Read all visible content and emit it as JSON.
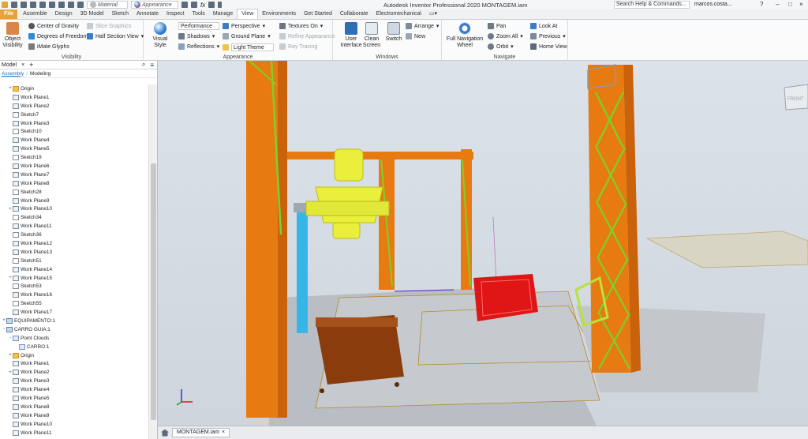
{
  "qat": {
    "material_label": "Material",
    "appearance_label": "Appearance",
    "fx_label": "fx"
  },
  "window": {
    "title": "Autodesk Inventor Professional 2020   MONTAGEM.iam",
    "search_placeholder": "Search Help & Commands...",
    "user": "marcos.costa..."
  },
  "tabs": [
    "File",
    "Assemble",
    "Design",
    "3D Model",
    "Sketch",
    "Annotate",
    "Inspect",
    "Tools",
    "Manage",
    "View",
    "Environments",
    "Get Started",
    "Collaborate",
    "Electromechanical"
  ],
  "active_tab": "View",
  "ribbon": {
    "visibility": {
      "label": "Visibility",
      "object_visibility": "Object Visibility",
      "center_of_gravity": "Center of Gravity",
      "degrees_of_freedom": "Degrees of Freedom",
      "imate_glyphs": "iMate Glyphs",
      "slice_graphics": "Slice Graphics",
      "half_section_view": "Half Section View"
    },
    "appearance": {
      "label": "Appearance",
      "visual_style": "Visual Style",
      "performance": "Performance",
      "shadows": "Shadows",
      "reflections": "Reflections",
      "perspective": "Perspective",
      "ground_plane": "Ground Plane",
      "light_theme": "Light Theme",
      "textures_on": "Textures On",
      "refine_appearance": "Refine Appearance",
      "ray_tracing": "Ray Tracing"
    },
    "windows": {
      "label": "Windows",
      "user_interface": "User Interface",
      "clean_screen": "Clean Screen",
      "switch": "Switch",
      "arrange": "Arrange",
      "new": "New"
    },
    "navigate": {
      "label": "Navigate",
      "full_nav_wheel": "Full Navigation Wheel",
      "pan": "Pan",
      "zoom_all": "Zoom All",
      "orbit": "Orbit",
      "look_at": "Look At",
      "previous": "Previous",
      "home_view": "Home View"
    }
  },
  "browser": {
    "title": "Model",
    "tab_assembly": "Assembly",
    "tab_modeling": "Modeling",
    "tree": [
      {
        "label": "Origin",
        "type": "folder",
        "indent": 1,
        "exp": "+"
      },
      {
        "label": "Work Plane1",
        "type": "plane",
        "indent": 1,
        "exp": ""
      },
      {
        "label": "Work Plane2",
        "type": "plane",
        "indent": 1,
        "exp": ""
      },
      {
        "label": "Sketch7",
        "type": "sketch",
        "indent": 1,
        "exp": ""
      },
      {
        "label": "Work Plane3",
        "type": "plane",
        "indent": 1,
        "exp": ""
      },
      {
        "label": "Sketch10",
        "type": "sketch",
        "indent": 1,
        "exp": ""
      },
      {
        "label": "Work Plane4",
        "type": "plane",
        "indent": 1,
        "exp": ""
      },
      {
        "label": "Work Plane5",
        "type": "plane",
        "indent": 1,
        "exp": ""
      },
      {
        "label": "Sketch19",
        "type": "sketch",
        "indent": 1,
        "exp": ""
      },
      {
        "label": "Work Plane6",
        "type": "plane",
        "indent": 1,
        "exp": ""
      },
      {
        "label": "Work Plane7",
        "type": "plane",
        "indent": 1,
        "exp": ""
      },
      {
        "label": "Work Plane8",
        "type": "plane",
        "indent": 1,
        "exp": ""
      },
      {
        "label": "Sketch28",
        "type": "sketch",
        "indent": 1,
        "exp": ""
      },
      {
        "label": "Work Plane9",
        "type": "plane",
        "indent": 1,
        "exp": ""
      },
      {
        "label": "Work Plane10",
        "type": "plane",
        "indent": 1,
        "exp": "+"
      },
      {
        "label": "Sketch34",
        "type": "sketch",
        "indent": 1,
        "exp": ""
      },
      {
        "label": "Work Plane11",
        "type": "plane",
        "indent": 1,
        "exp": ""
      },
      {
        "label": "Sketch36",
        "type": "sketch",
        "indent": 1,
        "exp": ""
      },
      {
        "label": "Work Plane12",
        "type": "plane",
        "indent": 1,
        "exp": ""
      },
      {
        "label": "Work Plane13",
        "type": "plane",
        "indent": 1,
        "exp": ""
      },
      {
        "label": "Sketch51",
        "type": "sketch",
        "indent": 1,
        "exp": ""
      },
      {
        "label": "Work Plane14",
        "type": "plane",
        "indent": 1,
        "exp": ""
      },
      {
        "label": "Work Plane15",
        "type": "plane",
        "indent": 1,
        "exp": "+"
      },
      {
        "label": "Sketch53",
        "type": "sketch",
        "indent": 1,
        "exp": ""
      },
      {
        "label": "Work Plane16",
        "type": "plane",
        "indent": 1,
        "exp": ""
      },
      {
        "label": "Sketch55",
        "type": "sketch",
        "indent": 1,
        "exp": ""
      },
      {
        "label": "Work Plane17",
        "type": "plane",
        "indent": 1,
        "exp": ""
      },
      {
        "label": "EQUIPAMENTO:1",
        "type": "asm",
        "indent": 0,
        "exp": "+"
      },
      {
        "label": "CARRO GUIA:1",
        "type": "asm",
        "indent": 0,
        "exp": "-"
      },
      {
        "label": "Point Clouds",
        "type": "cloud",
        "indent": 1,
        "exp": "-"
      },
      {
        "label": "CARRO:1",
        "type": "cloud",
        "indent": 2,
        "exp": ""
      },
      {
        "label": "Origin",
        "type": "folder",
        "indent": 1,
        "exp": "+"
      },
      {
        "label": "Work Plane1",
        "type": "plane",
        "indent": 1,
        "exp": ""
      },
      {
        "label": "Work Plane2",
        "type": "plane",
        "indent": 1,
        "exp": "+"
      },
      {
        "label": "Work Plane3",
        "type": "plane",
        "indent": 1,
        "exp": ""
      },
      {
        "label": "Work Plane4",
        "type": "plane",
        "indent": 1,
        "exp": ""
      },
      {
        "label": "Work Plane5",
        "type": "plane",
        "indent": 1,
        "exp": ""
      },
      {
        "label": "Work Plane8",
        "type": "plane",
        "indent": 1,
        "exp": ""
      },
      {
        "label": "Work Plane9",
        "type": "plane",
        "indent": 1,
        "exp": ""
      },
      {
        "label": "Work Plane10",
        "type": "plane",
        "indent": 1,
        "exp": ""
      },
      {
        "label": "Work Plane11",
        "type": "plane",
        "indent": 1,
        "exp": ""
      }
    ]
  },
  "viewcube_label": "FRONT",
  "document_tab": "MONTAGEM.iam",
  "colors": {
    "file_tab": "#e8a23a",
    "column_orange": "#e87a12",
    "brace_green": "#7ad22a",
    "equipment_yellow": "#e9ef3a",
    "cart_red": "#e01515",
    "cart_brown": "#8a3c0c",
    "cloud_blue": "#36b6e6"
  }
}
